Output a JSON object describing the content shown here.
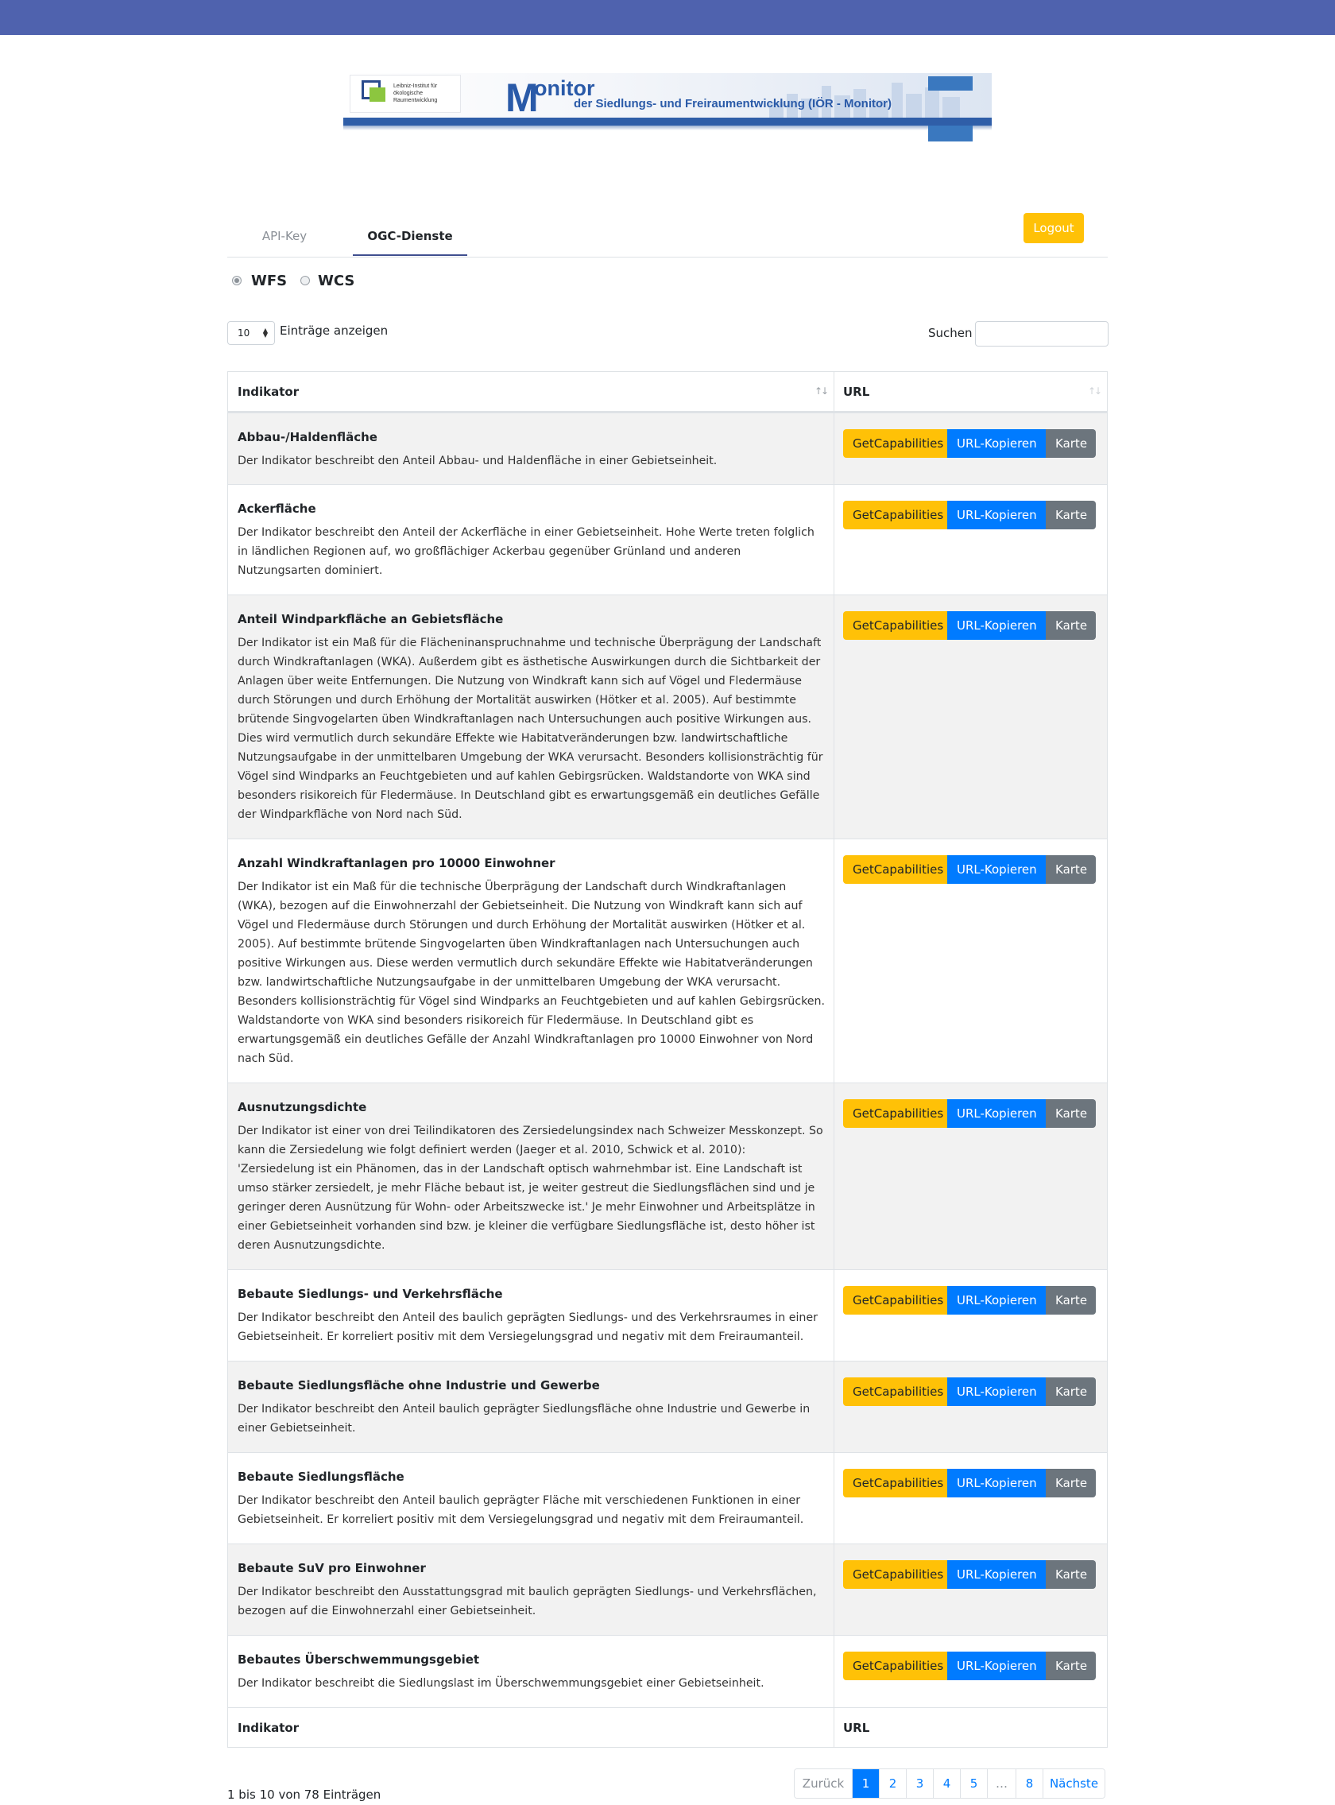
{
  "banner": {
    "institute": "Leibniz-Institut für ökologische Raumentwicklung",
    "big_letter": "M",
    "title": "onitor",
    "subtitle": "der Siedlungs- und Freiraumentwicklung  (IÖR - Monitor)"
  },
  "tabs": [
    {
      "label": "API-Key",
      "active": false
    },
    {
      "label": "OGC-Dienste",
      "active": true
    }
  ],
  "logout_label": "Logout",
  "service_options": [
    {
      "label": "WFS",
      "checked": true
    },
    {
      "label": "WCS",
      "checked": false
    }
  ],
  "length": {
    "value": "10",
    "label": "Einträge anzeigen"
  },
  "search": {
    "label": "Suchen",
    "value": ""
  },
  "table": {
    "columns": [
      "Indikator",
      "URL"
    ],
    "buttons": {
      "getcap": "GetCapabilities",
      "copy": "URL-Kopieren",
      "map": "Karte"
    },
    "rows": [
      {
        "title": "Abbau-/Haldenfläche",
        "desc": "Der Indikator beschreibt den Anteil Abbau- und Haldenfläche in einer Gebietseinheit."
      },
      {
        "title": "Ackerfläche",
        "desc": "Der Indikator beschreibt den Anteil der Ackerfläche in einer Gebietseinheit. Hohe Werte treten folglich in ländlichen Regionen auf, wo großflächiger Ackerbau gegenüber Grünland und anderen Nutzungsarten dominiert."
      },
      {
        "title": "Anteil Windparkfläche an Gebietsfläche",
        "desc": "Der Indikator ist ein Maß für die Flächeninanspruchnahme und technische Überprägung der Landschaft durch Windkraftanlagen (WKA). Außerdem gibt es ästhetische Auswirkungen durch die Sichtbarkeit der Anlagen über weite Entfernungen. Die Nutzung von Windkraft kann sich auf Vögel und Fledermäuse durch Störungen und durch Erhöhung der Mortalität auswirken (Hötker et al. 2005). Auf bestimmte brütende Singvogelarten üben Windkraftanlagen nach Untersuchungen auch positive Wirkungen aus. Dies wird vermutlich durch sekundäre Effekte wie Habitatveränderungen bzw. landwirtschaftliche Nutzungsaufgabe in der unmittelbaren Umgebung der WKA verursacht. Besonders kollisionsträchtig für Vögel sind Windparks an Feuchtgebieten und auf kahlen Gebirgsrücken. Waldstandorte von WKA sind besonders risikoreich für Fledermäuse. In Deutschland gibt es erwartungsgemäß ein deutliches Gefälle der Windparkfläche von Nord nach Süd."
      },
      {
        "title": "Anzahl Windkraftanlagen pro 10000 Einwohner",
        "desc": "Der Indikator ist ein Maß für die technische Überprägung der Landschaft durch Windkraftanlagen (WKA), bezogen auf die Einwohnerzahl der Gebietseinheit. Die Nutzung von Windkraft kann sich auf Vögel und Fledermäuse durch Störungen und durch Erhöhung der Mortalität auswirken (Hötker et al. 2005). Auf bestimmte brütende Singvogelarten üben Windkraftanlagen nach Untersuchungen auch positive Wirkungen aus. Diese werden vermutlich durch sekundäre Effekte wie Habitatveränderungen bzw. landwirtschaftliche Nutzungsaufgabe in der unmittelbaren Umgebung der WKA verursacht. Besonders kollisionsträchtig für Vögel sind Windparks an Feuchtgebieten und auf kahlen Gebirgsrücken. Waldstandorte von WKA sind besonders risikoreich für Fledermäuse. In Deutschland gibt es erwartungsgemäß ein deutliches Gefälle der Anzahl Windkraftanlagen pro 10000 Einwohner von Nord nach Süd."
      },
      {
        "title": "Ausnutzungsdichte",
        "desc": "Der Indikator ist einer von drei Teilindikatoren des Zersiedelungsindex nach Schweizer Messkonzept. So kann die Zersiedelung wie folgt definiert werden (Jaeger et al. 2010, Schwick et al. 2010): 'Zersiedelung ist ein Phänomen, das in der Landschaft optisch wahrnehmbar ist. Eine Landschaft ist umso stärker zersiedelt, je mehr Fläche bebaut ist, je weiter gestreut die Siedlungsflächen sind und je geringer deren Ausnützung für Wohn- oder Arbeitszwecke ist.' Je mehr Einwohner und Arbeitsplätze in einer Gebietseinheit vorhanden sind bzw. je kleiner die verfügbare Siedlungsfläche ist, desto höher ist deren Ausnutzungsdichte."
      },
      {
        "title": "Bebaute Siedlungs- und Verkehrsfläche",
        "desc": "Der Indikator beschreibt den Anteil des baulich geprägten Siedlungs- und des Verkehrsraumes in einer Gebietseinheit. Er korreliert positiv mit dem Versiegelungsgrad und negativ mit dem Freiraumanteil."
      },
      {
        "title": "Bebaute Siedlungsfläche ohne Industrie und Gewerbe",
        "desc": "Der Indikator beschreibt den Anteil baulich geprägter Siedlungsfläche ohne Industrie und Gewerbe in einer Gebietseinheit."
      },
      {
        "title": "Bebaute Siedlungsfläche",
        "desc": "Der Indikator beschreibt den Anteil baulich geprägter Fläche mit verschiedenen Funktionen in einer Gebietseinheit. Er korreliert positiv mit dem Versiegelungsgrad und negativ mit dem Freiraumanteil."
      },
      {
        "title": "Bebaute SuV pro Einwohner",
        "desc": "Der Indikator beschreibt den Ausstattungsgrad mit baulich geprägten Siedlungs- und Verkehrsflächen, bezogen auf die Einwohnerzahl einer Gebietseinheit."
      },
      {
        "title": "Bebautes Überschwemmungsgebiet",
        "desc": "Der Indikator beschreibt die Siedlungslast im Überschwemmungsgebiet einer Gebietseinheit."
      }
    ]
  },
  "info": "1 bis 10 von 78 Einträgen",
  "pagination": [
    "Zurück",
    "1",
    "2",
    "3",
    "4",
    "5",
    "…",
    "8",
    "Nächste"
  ]
}
